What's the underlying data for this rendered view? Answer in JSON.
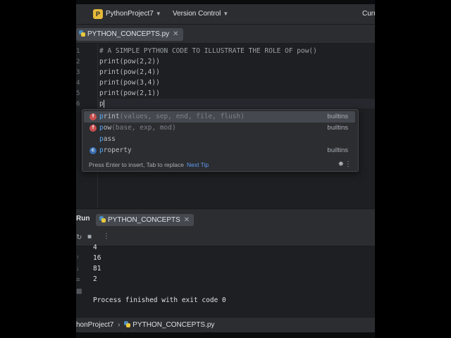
{
  "topbar": {
    "project_badge": "P",
    "project_name": "PythonProject7",
    "vcs": "Version Control",
    "right_fragment": "Curr"
  },
  "editor": {
    "file_tab": "PYTHON_CONCEPTS.py",
    "gutter_numbers": [
      "1",
      "2",
      "3",
      "4",
      "5",
      "6"
    ],
    "lines": [
      "# A SIMPLE PYTHON CODE TO ILLUSTRATE THE ROLE OF pow()",
      "print(pow(2,2))",
      "print(pow(2,4))",
      "print(pow(3,4))",
      "print(pow(2,1))",
      "p"
    ]
  },
  "completion": {
    "items": [
      {
        "icon": "function-icon",
        "match": "p",
        "rest": "rint",
        "params": "(values, sep, end, file, flush)",
        "source": "builtins"
      },
      {
        "icon": "function-icon",
        "match": "p",
        "rest": "ow",
        "params": "(base, exp, mod)",
        "source": "builtins"
      },
      {
        "icon": "",
        "match": "p",
        "rest": "ass",
        "params": "",
        "source": ""
      },
      {
        "icon": "property-icon",
        "match": "p",
        "rest": "roperty",
        "params": "",
        "source": "builtins"
      }
    ],
    "hint": "Press Enter to insert, Tab to replace",
    "next_tip": "Next Tip"
  },
  "run": {
    "label": "Run",
    "tab": "PYTHON_CONCEPTS",
    "output": [
      "4",
      "16",
      "81",
      "2",
      "",
      "Process finished with exit code 0"
    ]
  },
  "statusbar": {
    "project": "honProject7",
    "file": "PYTHON_CONCEPTS.py"
  },
  "colors": {
    "background": "#1e1f22",
    "panel": "#2b2d30",
    "accent_link": "#5e9cf5",
    "project_badge": "#e5b93a"
  }
}
